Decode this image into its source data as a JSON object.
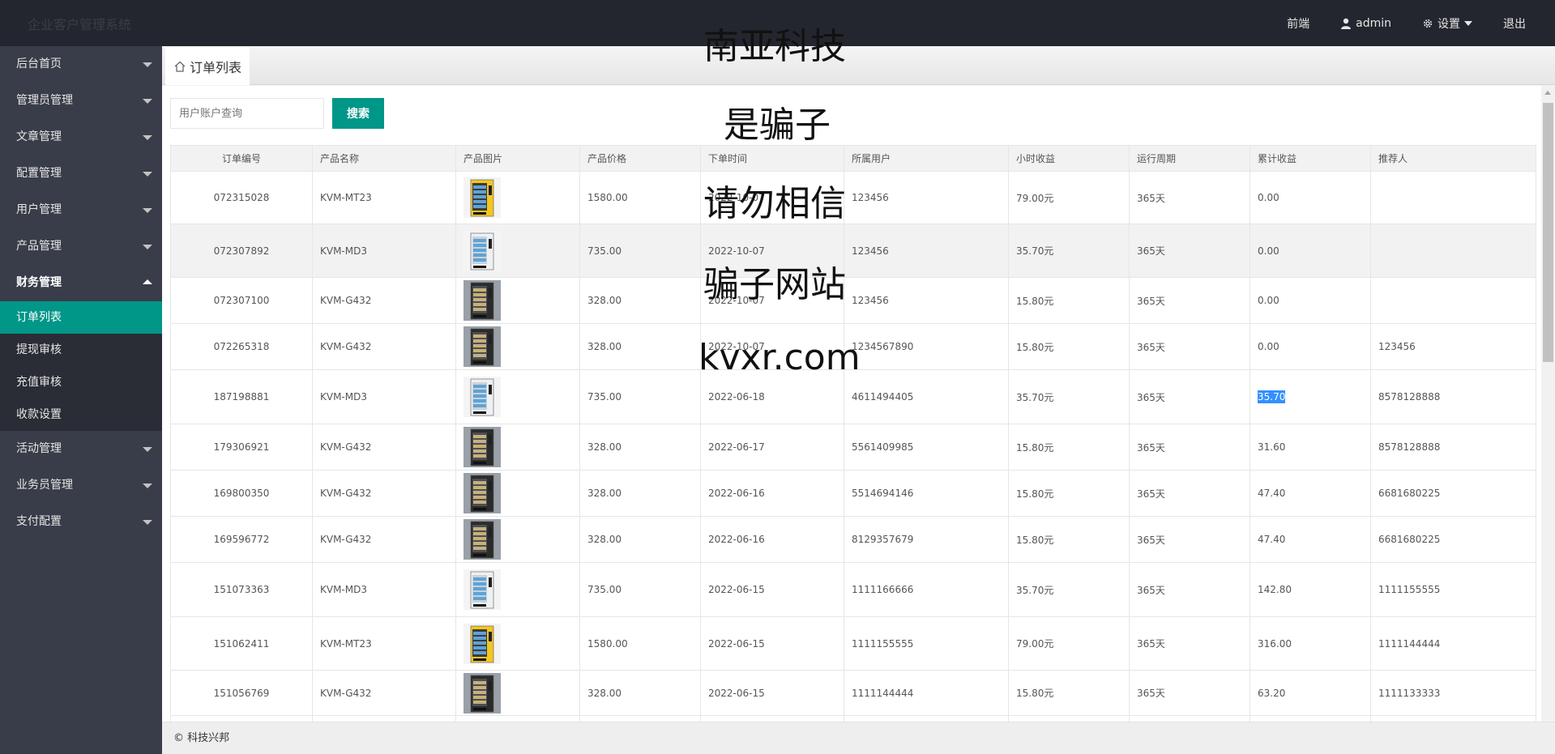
{
  "header": {
    "logo": "企业客户管理系统",
    "nav": {
      "front": "前端",
      "admin": "admin",
      "settings": "设置",
      "logout": "退出"
    }
  },
  "sidebar": {
    "items": [
      {
        "label": "后台首页"
      },
      {
        "label": "管理员管理"
      },
      {
        "label": "文章管理"
      },
      {
        "label": "配置管理"
      },
      {
        "label": "用户管理"
      },
      {
        "label": "产品管理"
      },
      {
        "label": "财务管理"
      }
    ],
    "sub": [
      {
        "label": "订单列表"
      },
      {
        "label": "提现审核"
      },
      {
        "label": "充值审核"
      },
      {
        "label": "收款设置"
      }
    ],
    "after": [
      {
        "label": "活动管理"
      },
      {
        "label": "业务员管理"
      },
      {
        "label": "支付配置"
      }
    ]
  },
  "tab": {
    "label": "订单列表"
  },
  "search": {
    "placeholder": "用户账户查询",
    "button": "搜索"
  },
  "table": {
    "headers": [
      "订单编号",
      "产品名称",
      "产品图片",
      "产品价格",
      "下单时间",
      "所属用户",
      "小时收益",
      "运行周期",
      "累计收益",
      "推荐人"
    ],
    "rows": [
      {
        "id": "072315028",
        "name": "KVM-MT23",
        "img": "yellow",
        "price": "1580.00",
        "time": "2022-10-07",
        "user": "123456",
        "hourly": "79.00元",
        "cycle": "365天",
        "total": "0.00",
        "ref": ""
      },
      {
        "id": "072307892",
        "name": "KVM-MD3",
        "img": "white",
        "price": "735.00",
        "time": "2022-10-07",
        "user": "123456",
        "hourly": "35.70元",
        "cycle": "365天",
        "total": "0.00",
        "ref": ""
      },
      {
        "id": "072307100",
        "name": "KVM-G432",
        "img": "black",
        "price": "328.00",
        "time": "2022-10-07",
        "user": "123456",
        "hourly": "15.80元",
        "cycle": "365天",
        "total": "0.00",
        "ref": ""
      },
      {
        "id": "072265318",
        "name": "KVM-G432",
        "img": "black",
        "price": "328.00",
        "time": "2022-10-07",
        "user": "1234567890",
        "hourly": "15.80元",
        "cycle": "365天",
        "total": "0.00",
        "ref": "123456"
      },
      {
        "id": "187198881",
        "name": "KVM-MD3",
        "img": "white",
        "price": "735.00",
        "time": "2022-06-18",
        "user": "4611494405",
        "hourly": "35.70元",
        "cycle": "365天",
        "total": "35.70",
        "ref": "8578128888"
      },
      {
        "id": "179306921",
        "name": "KVM-G432",
        "img": "black",
        "price": "328.00",
        "time": "2022-06-17",
        "user": "5561409985",
        "hourly": "15.80元",
        "cycle": "365天",
        "total": "31.60",
        "ref": "8578128888"
      },
      {
        "id": "169800350",
        "name": "KVM-G432",
        "img": "black",
        "price": "328.00",
        "time": "2022-06-16",
        "user": "5514694146",
        "hourly": "15.80元",
        "cycle": "365天",
        "total": "47.40",
        "ref": "6681680225"
      },
      {
        "id": "169596772",
        "name": "KVM-G432",
        "img": "black",
        "price": "328.00",
        "time": "2022-06-16",
        "user": "8129357679",
        "hourly": "15.80元",
        "cycle": "365天",
        "total": "47.40",
        "ref": "6681680225"
      },
      {
        "id": "151073363",
        "name": "KVM-MD3",
        "img": "white",
        "price": "735.00",
        "time": "2022-06-15",
        "user": "1111166666",
        "hourly": "35.70元",
        "cycle": "365天",
        "total": "142.80",
        "ref": "1111155555"
      },
      {
        "id": "151062411",
        "name": "KVM-MT23",
        "img": "yellow",
        "price": "1580.00",
        "time": "2022-06-15",
        "user": "1111155555",
        "hourly": "79.00元",
        "cycle": "365天",
        "total": "316.00",
        "ref": "1111144444"
      },
      {
        "id": "151056769",
        "name": "KVM-G432",
        "img": "black",
        "price": "328.00",
        "time": "2022-06-15",
        "user": "1111144444",
        "hourly": "15.80元",
        "cycle": "365天",
        "total": "63.20",
        "ref": "1111133333"
      }
    ]
  },
  "footer": "© 科技兴邦",
  "watermark": [
    "南亚科技",
    "是骗子",
    "请勿相信",
    "骗子网站",
    "kvxr.com"
  ],
  "colors": {
    "accent": "#009688",
    "header": "#23262e",
    "sidebar": "#393d49",
    "selection": "#3390ff"
  }
}
